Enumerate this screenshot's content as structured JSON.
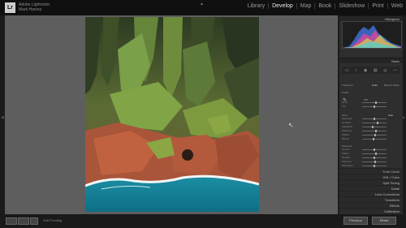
{
  "app": {
    "logo": "Lr",
    "identity_line1": "Adobe Lightroom",
    "identity_line2": "Mark Harvey"
  },
  "modules": [
    "Library",
    "Develop",
    "Map",
    "Book",
    "Slideshow",
    "Print",
    "Web"
  ],
  "active_module": "Develop",
  "right_panel": {
    "histogram_label": "Histogram",
    "basic_label": "Basic",
    "treatment_label": "Treatment",
    "color_label": "Color",
    "bw_label": "Black & White",
    "profile_label": "Profile",
    "wb_label": "WB",
    "tone_label": "Tone",
    "auto_label": "Auto",
    "presence_label": "Presence",
    "sliders": [
      {
        "label": "Temp",
        "value": 0.55
      },
      {
        "label": "Tint",
        "value": 0.5
      },
      {
        "label": "Exposure",
        "value": 0.5
      },
      {
        "label": "Contrast",
        "value": 0.62
      },
      {
        "label": "Highlights",
        "value": 0.42
      },
      {
        "label": "Shadows",
        "value": 0.58
      },
      {
        "label": "Whites",
        "value": 0.52
      },
      {
        "label": "Blacks",
        "value": 0.47
      },
      {
        "label": "Texture",
        "value": 0.5
      },
      {
        "label": "Clarity",
        "value": 0.56
      },
      {
        "label": "Dehaze",
        "value": 0.5
      },
      {
        "label": "Vibrance",
        "value": 0.54
      },
      {
        "label": "Saturation",
        "value": 0.5
      }
    ],
    "panels": [
      "Tone Curve",
      "HSL / Color",
      "Split Toning",
      "Detail",
      "Lens Corrections",
      "Transform",
      "Effects",
      "Calibration"
    ],
    "previous_label": "Previous",
    "reset_label": "Reset"
  },
  "bottom": {
    "soft_proofing_label": "Soft Proofing"
  },
  "colors": {
    "viewer_bg": "#5e5e5e",
    "panel_bg": "#2e2e2e",
    "topbar_bg": "#101010",
    "ocean": "#137f95",
    "cliff_red": "#b0543a",
    "moss": "#7a9a3e"
  },
  "icons": [
    "lr-logo-icon",
    "crop-tool-icon",
    "spot-removal-icon",
    "red-eye-icon",
    "graduated-filter-icon",
    "radial-filter-icon",
    "brush-icon",
    "wb-picker-icon",
    "cursor-icon"
  ]
}
